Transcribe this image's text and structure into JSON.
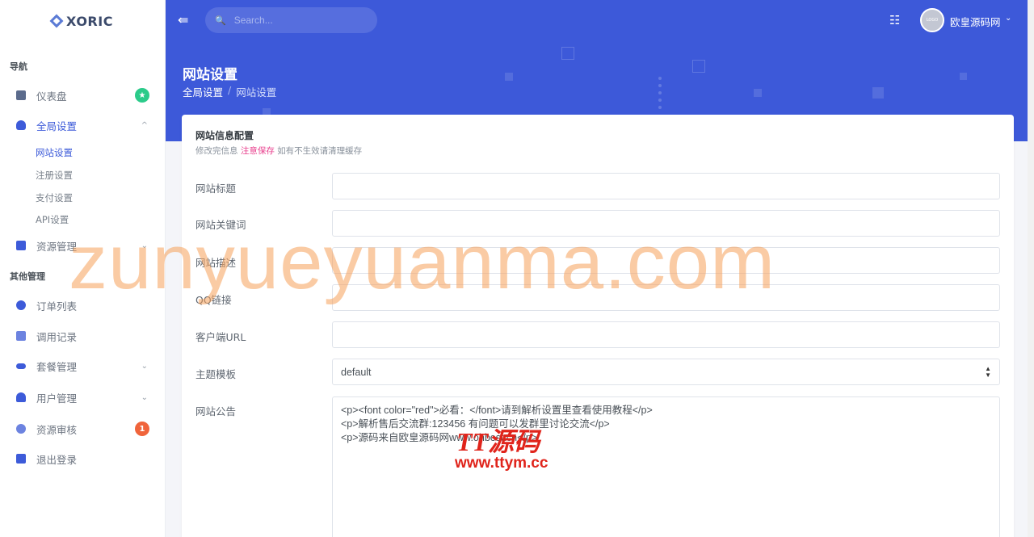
{
  "brand": {
    "name": "XORIC"
  },
  "sidebar": {
    "section_nav": "导航",
    "section_other": "其他管理",
    "items": [
      {
        "label": "仪表盘",
        "icon": "monitor-icon",
        "badge": "★",
        "badge_color": "#2bcb8a"
      },
      {
        "label": "全局设置",
        "icon": "layers-icon",
        "chevron": "^"
      },
      {
        "label": "资源管理",
        "icon": "grid-icon",
        "chevron": "⌄"
      },
      {
        "label": "订单列表",
        "icon": "circle-icon"
      },
      {
        "label": "调用记录",
        "icon": "chart-icon"
      },
      {
        "label": "套餐管理",
        "icon": "pill-icon",
        "chevron": "⌄"
      },
      {
        "label": "用户管理",
        "icon": "user-icon",
        "chevron": "⌄"
      },
      {
        "label": "资源审核",
        "icon": "review-icon",
        "badge": "1",
        "badge_color": "#f0643b"
      },
      {
        "label": "退出登录",
        "icon": "logout-icon"
      }
    ],
    "sub_items": [
      "网站设置",
      "注册设置",
      "支付设置",
      "API设置"
    ]
  },
  "header": {
    "search_placeholder": "Search...",
    "user_name": "欧皇源码网",
    "avatar_text": "LOGO",
    "page_title": "网站设置",
    "breadcrumb": [
      "全局设置",
      "/",
      "网站设置"
    ]
  },
  "card": {
    "title": "网站信息配置",
    "subtitle_prefix": "修改完信息",
    "subtitle_highlight": "注意保存",
    "subtitle_suffix": "如有不生效请清理缓存",
    "fields": [
      {
        "label": "网站标题",
        "value": ""
      },
      {
        "label": "网站关键词",
        "value": ""
      },
      {
        "label": "网站描述",
        "value": ""
      },
      {
        "label": "QQ链接",
        "value": ""
      },
      {
        "label": "客户端URL",
        "value": ""
      }
    ],
    "theme_label": "主题模板",
    "theme_value": "default",
    "notice_label": "网站公告",
    "notice_lines": [
      "<p><font color=\"red\">必看：</font>请到解析设置里查看使用教程</p>",
      "<p>解析售后交流群:123456 有问题可以发群里讨论交流</p>",
      "<p>源码来自欧皇源码网www.ohbest.cn</p>"
    ]
  },
  "watermark": {
    "main": "zunyueyuanma.com",
    "logo": "TT源码",
    "url": "www.ttym.cc"
  },
  "colors": {
    "accent": "#3d59d9",
    "active": "#3d5bd9",
    "highlight": "#e83e8c"
  }
}
